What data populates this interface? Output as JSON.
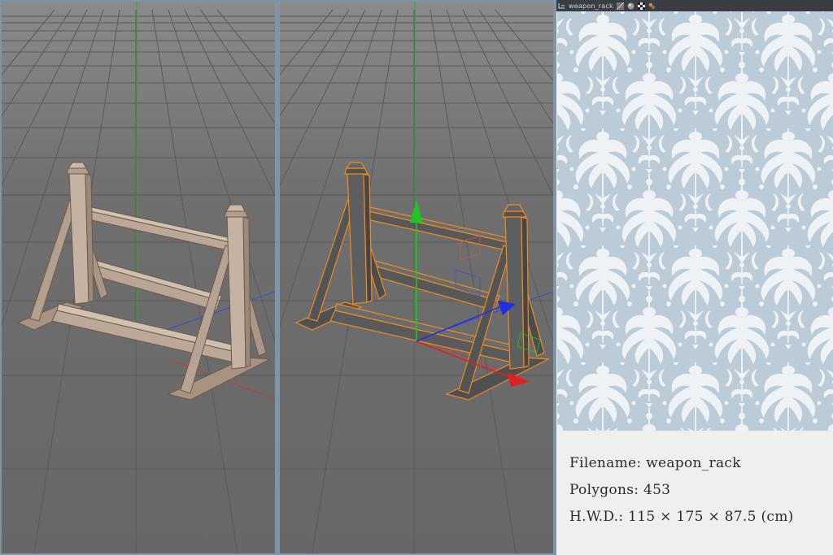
{
  "thumbnail_bar": {
    "filename_label": "weapon_rack",
    "icons": [
      "hierarchy-icon",
      "checker-icon",
      "sphere-icon",
      "checkerboard-icon",
      "texture-icon"
    ]
  },
  "viewports": [
    {
      "name": "textured-view",
      "object": "weapon rack",
      "shading": "textured"
    },
    {
      "name": "shaded-selected-view",
      "object": "weapon rack",
      "shading": "gray with orange selection outline",
      "axes": [
        "x-red",
        "y-green",
        "z-blue"
      ]
    }
  ],
  "info": {
    "filename": "Filename: weapon_rack",
    "polygons": "Polygons: 453",
    "dimensions": "H.W.D.: 115 × 175 × 87.5 (cm)"
  },
  "colors": {
    "viewport_bg": "#6e6e6e",
    "grid_line": "#555555",
    "wood": "#b9a696",
    "wood_dark": "#8b7766",
    "shaded_model": "#545658",
    "selection_outline": "#f08a1e",
    "axis_x": "#e02020",
    "axis_y": "#22c422",
    "axis_z": "#2030e0",
    "pattern_bg": "#bccbd8",
    "pattern_fg": "#f2f5f8",
    "info_bg": "#eef0ee"
  }
}
